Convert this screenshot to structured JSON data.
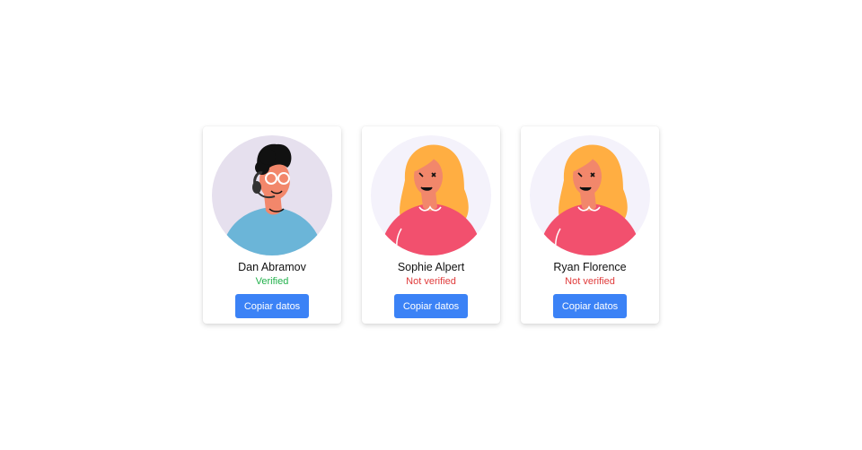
{
  "users": [
    {
      "name": "Dan Abramov",
      "status": "Verified",
      "verified": true,
      "button_label": "Copiar datos",
      "avatar_icon": "man-with-headset-avatar-icon"
    },
    {
      "name": "Sophie Alpert",
      "status": "Not verified",
      "verified": false,
      "button_label": "Copiar datos",
      "avatar_icon": "woman-avatar-icon"
    },
    {
      "name": "Ryan Florence",
      "status": "Not verified",
      "verified": false,
      "button_label": "Copiar datos",
      "avatar_icon": "woman-avatar-icon"
    }
  ],
  "colors": {
    "button": "#3b82f6",
    "verified": "#22b14c",
    "not_verified": "#e03a3a"
  }
}
